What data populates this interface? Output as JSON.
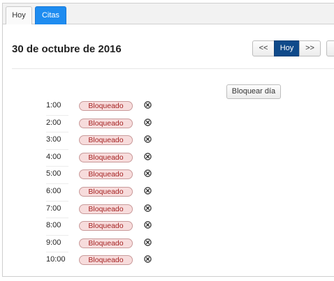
{
  "tabs": [
    {
      "label": "Hoy"
    },
    {
      "label": "Citas"
    }
  ],
  "header": {
    "date_title": "30 de octubre de 2016"
  },
  "navigation": {
    "prev_label": "<<",
    "today_label": "Hoy",
    "next_label": ">>"
  },
  "actions": {
    "block_day_label": "Bloquear día"
  },
  "slots": [
    {
      "time": "1:00",
      "status": "Bloqueado"
    },
    {
      "time": "2:00",
      "status": "Bloqueado"
    },
    {
      "time": "3:00",
      "status": "Bloqueado"
    },
    {
      "time": "4:00",
      "status": "Bloqueado"
    },
    {
      "time": "5:00",
      "status": "Bloqueado"
    },
    {
      "time": "6:00",
      "status": "Bloqueado"
    },
    {
      "time": "7:00",
      "status": "Bloqueado"
    },
    {
      "time": "8:00",
      "status": "Bloqueado"
    },
    {
      "time": "9:00",
      "status": "Bloqueado"
    },
    {
      "time": "10:00",
      "status": "Bloqueado"
    }
  ],
  "colors": {
    "active_tab": "#1e8cf0",
    "today_button": "#0f4a8a",
    "blocked_badge_bg": "#f7dcdc",
    "blocked_badge_text": "#a52222"
  },
  "icons": {
    "remove": "circle-x-icon"
  }
}
